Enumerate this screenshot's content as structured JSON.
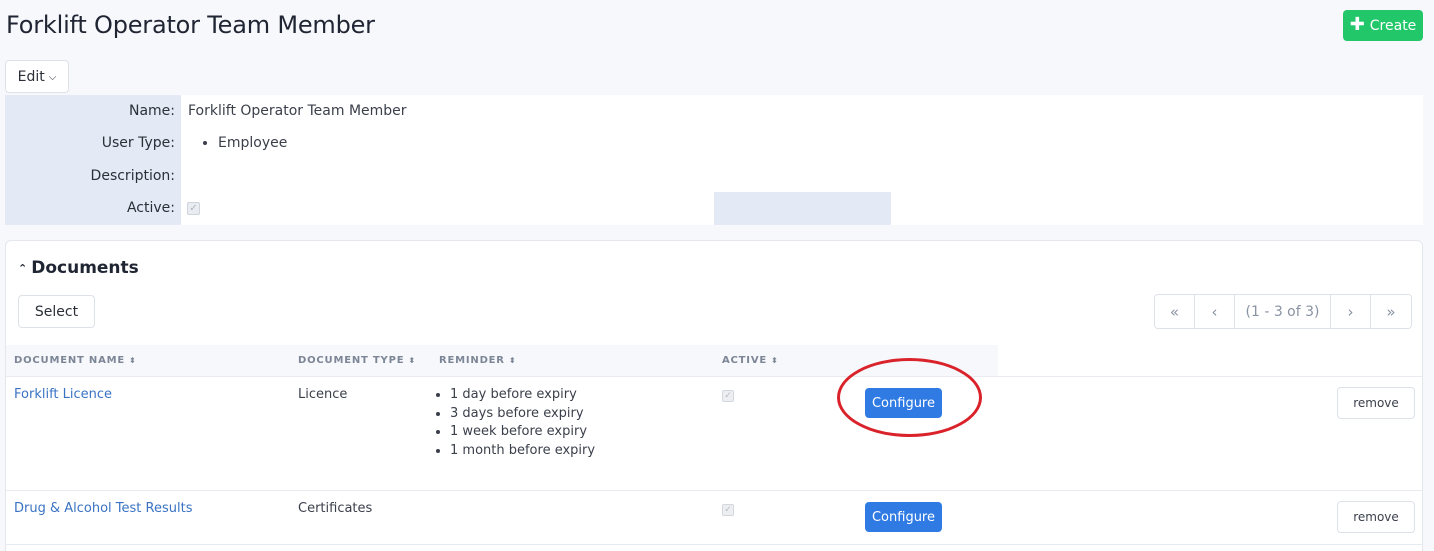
{
  "header": {
    "title": "Forklift Operator Team Member",
    "create_label": "Create",
    "edit_label": "Edit"
  },
  "details": {
    "name_label": "Name:",
    "name_value": "Forklift Operator Team Member",
    "user_type_label": "User Type:",
    "user_types": [
      "Employee"
    ],
    "description_label": "Description:",
    "description_value": "",
    "active_label": "Active:",
    "active_checked": true
  },
  "documents": {
    "title": "Documents",
    "select_label": "Select",
    "pager": {
      "first": "«",
      "prev": "‹",
      "info": "(1 - 3 of 3)",
      "next": "›",
      "last": "»"
    },
    "columns": [
      "DOCUMENT NAME",
      "DOCUMENT TYPE",
      "REMINDER",
      "ACTIVE"
    ],
    "rows": [
      {
        "name": "Forklift Licence",
        "type": "Licence",
        "reminders": [
          "1 day before expiry",
          "3 days before expiry",
          "1 week before expiry",
          "1 month before expiry"
        ],
        "active": true,
        "configure_label": "Configure",
        "remove_label": "remove"
      },
      {
        "name": "Drug & Alcohol Test Results",
        "type": "Certificates",
        "reminders": [],
        "active": true,
        "configure_label": "Configure",
        "remove_label": "remove"
      }
    ]
  },
  "colors": {
    "create_button": "#22c76a",
    "configure_button": "#2f7be3",
    "link": "#3a73c4",
    "highlight": "#d9222a",
    "label_background": "#e3eaf5"
  }
}
